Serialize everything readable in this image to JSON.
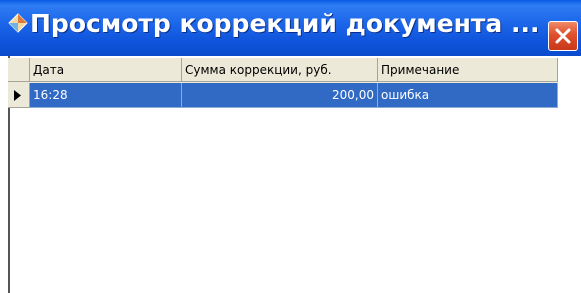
{
  "window": {
    "title": "Просмотр коррекций документа ...",
    "title_icon": "diamond-app-icon",
    "close_icon": "close-icon"
  },
  "grid": {
    "columns": [
      {
        "label": "Дата"
      },
      {
        "label": "Сумма коррекции, руб."
      },
      {
        "label": "Примечание"
      }
    ],
    "rows": [
      {
        "date": "16:28",
        "amount": "200,00",
        "note": "ошибка",
        "selected": true,
        "indicator_icon": "current-row-arrow-icon"
      }
    ]
  },
  "colors": {
    "titlebar": "#0e54dc",
    "selection": "#316ac5",
    "header": "#ece9d8",
    "close": "#e0502a"
  }
}
